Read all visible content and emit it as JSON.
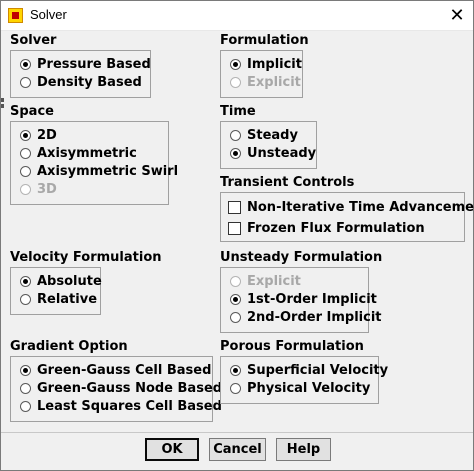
{
  "window": {
    "title": "Solver",
    "close_glyph": "✕"
  },
  "solver": {
    "title": "Solver",
    "options": [
      {
        "label": "Pressure Based",
        "selected": true,
        "enabled": true
      },
      {
        "label": "Density Based",
        "selected": false,
        "enabled": true
      }
    ]
  },
  "formulation": {
    "title": "Formulation",
    "options": [
      {
        "label": "Implicit",
        "selected": true,
        "enabled": true
      },
      {
        "label": "Explicit",
        "selected": false,
        "enabled": false
      }
    ]
  },
  "space": {
    "title": "Space",
    "options": [
      {
        "label": "2D",
        "selected": true,
        "enabled": true
      },
      {
        "label": "Axisymmetric",
        "selected": false,
        "enabled": true
      },
      {
        "label": "Axisymmetric Swirl",
        "selected": false,
        "enabled": true
      },
      {
        "label": "3D",
        "selected": false,
        "enabled": false
      }
    ]
  },
  "time": {
    "title": "Time",
    "options": [
      {
        "label": "Steady",
        "selected": false,
        "enabled": true
      },
      {
        "label": "Unsteady",
        "selected": true,
        "enabled": true
      }
    ]
  },
  "transient_controls": {
    "title": "Transient Controls",
    "options": [
      {
        "label": "Non-Iterative Time Advancement",
        "checked": false
      },
      {
        "label": "Frozen Flux Formulation",
        "checked": false
      }
    ]
  },
  "velocity_formulation": {
    "title": "Velocity Formulation",
    "options": [
      {
        "label": "Absolute",
        "selected": true,
        "enabled": true
      },
      {
        "label": "Relative",
        "selected": false,
        "enabled": true
      }
    ]
  },
  "unsteady_formulation": {
    "title": "Unsteady Formulation",
    "options": [
      {
        "label": "Explicit",
        "selected": false,
        "enabled": false
      },
      {
        "label": "1st-Order Implicit",
        "selected": true,
        "enabled": true
      },
      {
        "label": "2nd-Order Implicit",
        "selected": false,
        "enabled": true
      }
    ]
  },
  "gradient_option": {
    "title": "Gradient Option",
    "options": [
      {
        "label": "Green-Gauss Cell Based",
        "selected": true,
        "enabled": true
      },
      {
        "label": "Green-Gauss Node Based",
        "selected": false,
        "enabled": true
      },
      {
        "label": "Least Squares Cell Based",
        "selected": false,
        "enabled": true
      }
    ]
  },
  "porous_formulation": {
    "title": "Porous Formulation",
    "options": [
      {
        "label": "Superficial Velocity",
        "selected": true,
        "enabled": true
      },
      {
        "label": "Physical Velocity",
        "selected": false,
        "enabled": true
      }
    ]
  },
  "buttons": {
    "ok": "OK",
    "cancel": "Cancel",
    "help": "Help"
  }
}
